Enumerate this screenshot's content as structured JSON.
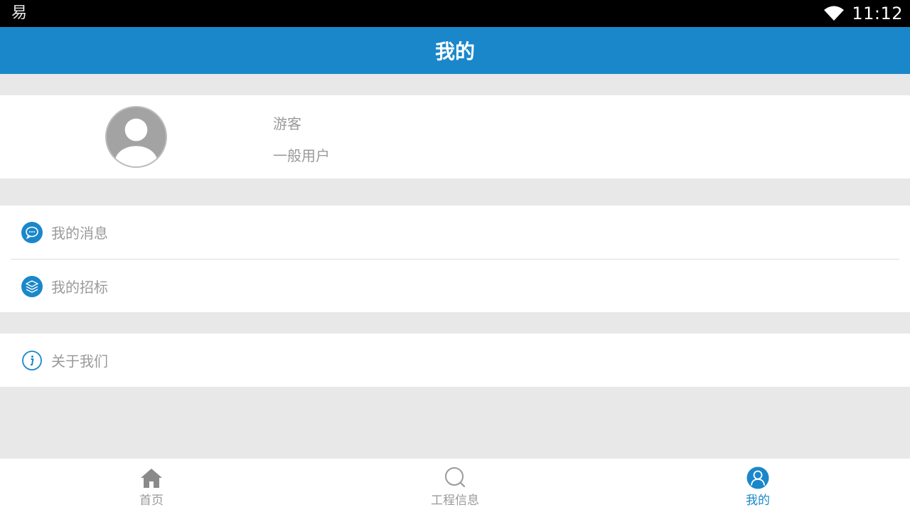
{
  "status_bar": {
    "app_icon_glyph": "易",
    "time": "11:12"
  },
  "header": {
    "title": "我的"
  },
  "profile": {
    "name": "游客",
    "role": "一般用户"
  },
  "menu": {
    "messages": {
      "label": "我的消息",
      "icon": "chat-bubble-icon"
    },
    "bids": {
      "label": "我的招标",
      "icon": "layers-icon"
    },
    "about": {
      "label": "关于我们",
      "icon": "info-icon"
    }
  },
  "tabs": [
    {
      "label": "首页",
      "icon": "home-icon",
      "active": false
    },
    {
      "label": "工程信息",
      "icon": "search-icon",
      "active": false
    },
    {
      "label": "我的",
      "icon": "user-icon",
      "active": true
    }
  ],
  "colors": {
    "accent": "#1a87cb",
    "text_muted": "#9a9a9a",
    "background": "#e8e8e8"
  }
}
